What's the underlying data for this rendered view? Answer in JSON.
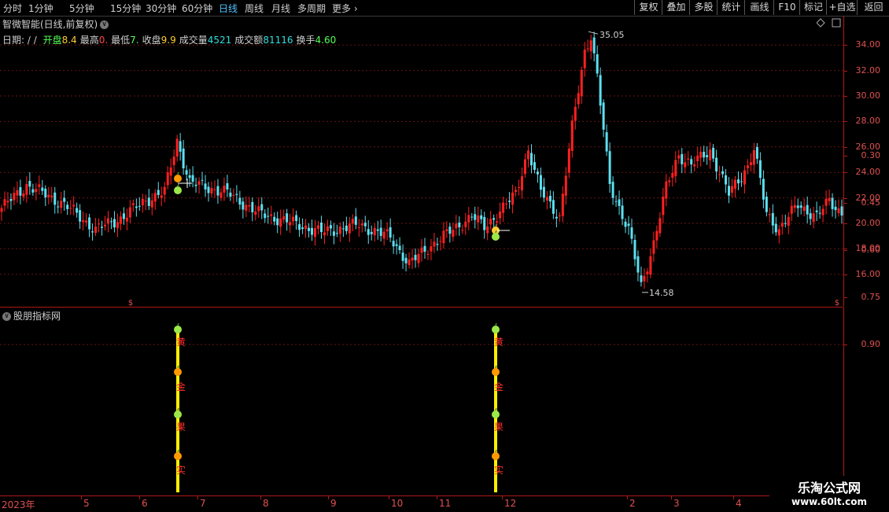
{
  "periods": [
    {
      "label": "分时",
      "active": false
    },
    {
      "label": "1分钟",
      "active": false
    },
    {
      "label": "5分钟",
      "active": false
    },
    {
      "label": "15分钟",
      "active": false
    },
    {
      "label": "30分钟",
      "active": false
    },
    {
      "label": "60分钟",
      "active": false
    },
    {
      "label": "日线",
      "active": true
    },
    {
      "label": "周线",
      "active": false
    },
    {
      "label": "月线",
      "active": false
    },
    {
      "label": "多周期",
      "active": false
    },
    {
      "label": "更多",
      "active": false
    }
  ],
  "toolbar": [
    "复权",
    "叠加",
    "多股",
    "统计",
    "画线",
    "F10",
    "标记",
    "+自选",
    "返回"
  ],
  "main_title": "智微智能(日线,前复权)",
  "info": {
    "date_label": "日期:",
    "date_value": "/ /",
    "items": [
      {
        "key": "开盘",
        "value": "8.4",
        "color": "#ffcc33"
      },
      {
        "key": "最高",
        "value": "0.",
        "color": "#ff4444"
      },
      {
        "key": "最低",
        "value": "7.",
        "color": "#55ff55"
      },
      {
        "key": "收盘",
        "value": "9.9",
        "color": "#ffcc33"
      },
      {
        "key": "成交量",
        "value": "4521",
        "color": "#33dddd"
      },
      {
        "key": "成交额",
        "value": "81116",
        "color": "#33dddd"
      },
      {
        "key": "换手",
        "value": "4.60",
        "color": "#55ff55"
      }
    ]
  },
  "colors": {
    "up": "#ff2020",
    "down": "#5ce0f0",
    "axis": "#e05050",
    "grid": "#6a1414",
    "signal": "#ffee00",
    "marker_text": "#ff3030"
  },
  "price_axis": [
    "34.00",
    "32.00",
    "30.00",
    "28.00",
    "26.00",
    "24.00",
    "22.00",
    "20.00",
    "18.00",
    "16.00"
  ],
  "extremes": {
    "high": "35.05",
    "low": "14.58"
  },
  "sub_title": "股朋指标网",
  "indicator_axis": [
    "0.90",
    "0.75",
    "0.60",
    "0.45",
    "0.30"
  ],
  "signal_labels": [
    "黄",
    "金",
    "果",
    "实"
  ],
  "dates": [
    "2023年",
    "5",
    "6",
    "7",
    "8",
    "9",
    "10",
    "11",
    "12",
    "2",
    "3",
    "4"
  ],
  "dollar_marker": "$",
  "watermark": {
    "title": "乐淘公式网",
    "url": "www.60lt.com"
  },
  "chart_data": {
    "type": "candlestick",
    "price_range": [
      14.58,
      35.05
    ],
    "y_ticks": [
      16,
      18,
      20,
      22,
      24,
      26,
      28,
      30,
      32,
      34
    ],
    "anchors": [
      [
        0,
        21.2
      ],
      [
        8,
        23
      ],
      [
        20,
        21.5
      ],
      [
        30,
        19.5
      ],
      [
        38,
        20.4
      ],
      [
        46,
        21.8
      ],
      [
        52,
        22.5
      ],
      [
        56,
        26.5
      ],
      [
        60,
        23.2
      ],
      [
        72,
        22.4
      ],
      [
        82,
        20.8
      ],
      [
        92,
        20.1
      ],
      [
        102,
        19.3
      ],
      [
        114,
        19.9
      ],
      [
        124,
        18.9
      ],
      [
        130,
        16.8
      ],
      [
        136,
        18.1
      ],
      [
        144,
        19.5
      ],
      [
        150,
        20.6
      ],
      [
        154,
        19.7
      ],
      [
        158,
        20.7
      ],
      [
        164,
        22.3
      ],
      [
        168,
        25.8
      ],
      [
        172,
        22.5
      ],
      [
        178,
        20.5
      ],
      [
        182,
        27.5
      ],
      [
        186,
        33.5
      ],
      [
        188,
        34.8
      ],
      [
        190,
        31.5
      ],
      [
        194,
        23
      ],
      [
        200,
        19.5
      ],
      [
        204,
        15
      ],
      [
        208,
        18.5
      ],
      [
        212,
        22.8
      ],
      [
        216,
        25.4
      ],
      [
        220,
        24.6
      ],
      [
        226,
        25.7
      ],
      [
        232,
        22.3
      ],
      [
        238,
        24.5
      ],
      [
        240,
        25.8
      ],
      [
        244,
        20.8
      ],
      [
        248,
        19.5
      ],
      [
        254,
        21.5
      ],
      [
        260,
        20.5
      ],
      [
        264,
        21.8
      ],
      [
        268,
        20.8
      ]
    ]
  }
}
